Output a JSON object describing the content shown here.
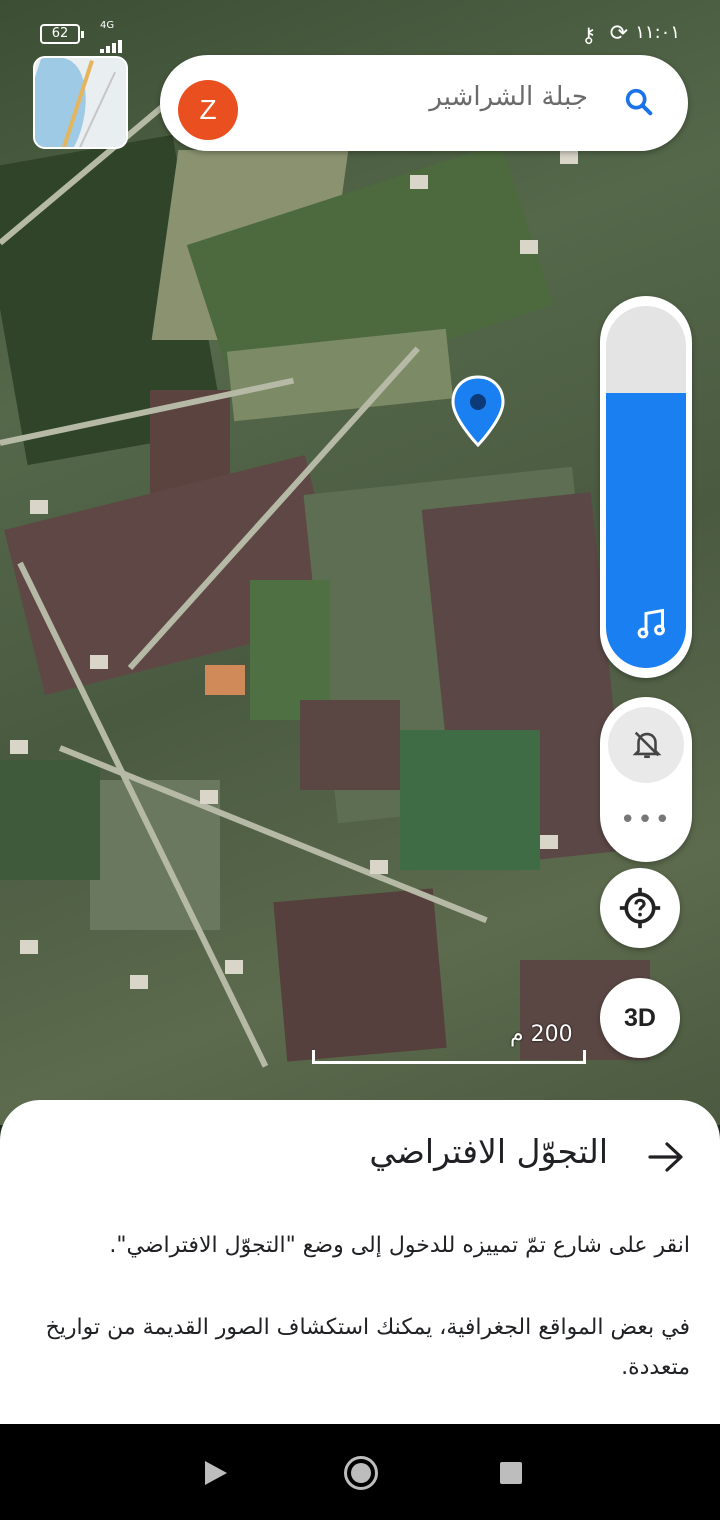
{
  "status_bar": {
    "battery": "62",
    "network": "4G",
    "time": "١١:٠١"
  },
  "search": {
    "avatar_letter": "Z",
    "query": "جبلة الشراشير"
  },
  "map": {
    "scale_label": "200 م"
  },
  "volume": {
    "level_percent": 76
  },
  "controls": {
    "more_dots": "•••",
    "three_d_label": "3D"
  },
  "sheet": {
    "title": "التجوّل الافتراضي",
    "line1": "انقر على شارع تمّ تمييزه للدخول إلى وضع \"التجوّل الافتراضي\".",
    "line2": "في بعض المواقع الجغرافية، يمكنك استكشاف الصور القديمة من تواريخ متعددة."
  },
  "colors": {
    "accent_blue": "#1a7ff0",
    "avatar_orange": "#ea4f1f"
  },
  "icons": [
    "search-icon",
    "location-marker-icon",
    "music-note-icon",
    "bell-off-icon",
    "help-location-icon",
    "arrow-right-icon",
    "key-icon",
    "sync-icon"
  ]
}
